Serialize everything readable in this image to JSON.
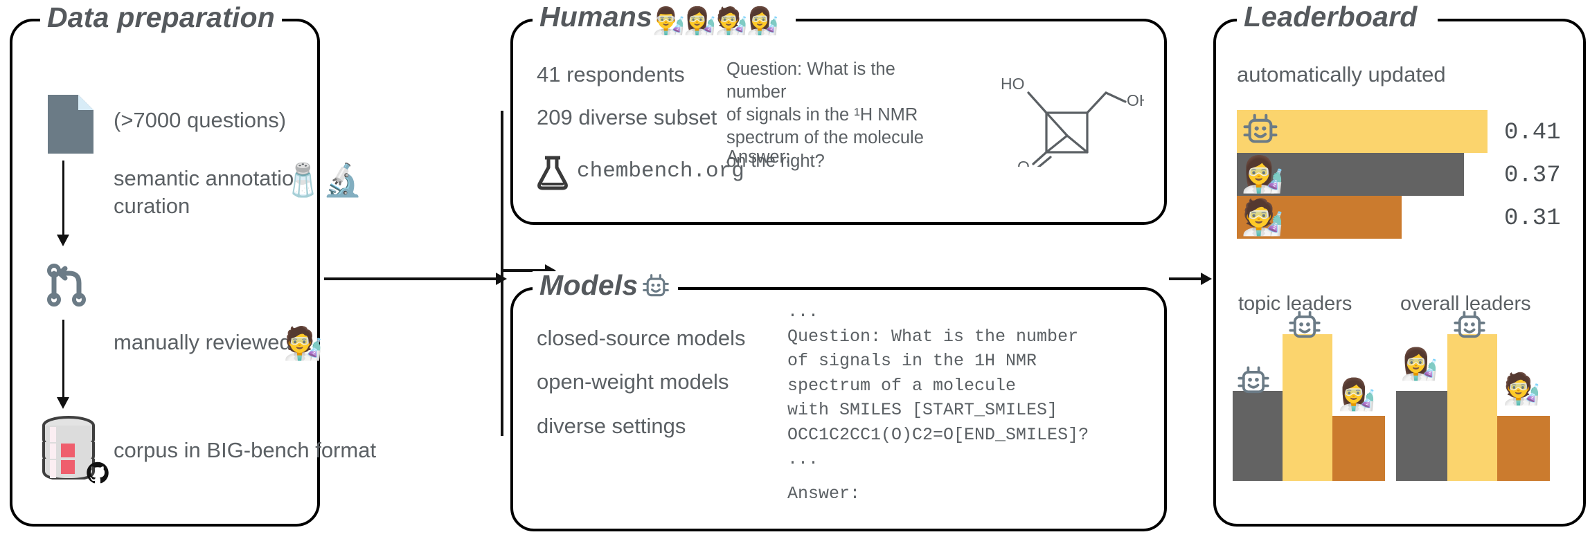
{
  "figure": {
    "panels": [
      "Data preparation",
      "Humans",
      "Models",
      "Leaderboard"
    ]
  },
  "data_preparation": {
    "title": "Data preparation",
    "steps": [
      {
        "icon": "document-icon",
        "label": "(>7000 questions)"
      },
      {
        "icon": "git-branch-icon",
        "label": "semantic annotation\ncuration",
        "line1": "semantic annotation",
        "line2": "curation"
      },
      {
        "icon": "git-branch-icon",
        "label": "manually reviewed"
      },
      {
        "icon": "database-icon",
        "label": "corpus in BIG-bench format"
      }
    ],
    "step1_label": "(>7000 questions)",
    "step2_line1": "semantic annotation",
    "step2_line2": "curation",
    "step3_label": "manually reviewed",
    "step4_label": "corpus in BIG-bench format",
    "badges": [
      "scientist-emoji",
      "scientist-emoji",
      "github-icon"
    ]
  },
  "humans": {
    "title": "Humans",
    "title_emojis": "👨‍🔬👩‍🔬🧑‍🔬👩‍🔬",
    "respondents": "41 respondents",
    "subset": "209 diverse subset",
    "site": "chembench.org",
    "site_icon": "flask-icon",
    "prompt_lines": [
      "Question: What is the number",
      "of signals in the ¹H NMR",
      "spectrum of the molecule",
      "on the right?"
    ],
    "answer_label": "Answer:",
    "molecule": {
      "name": "molecule-structure",
      "labels": [
        "HO",
        "OH",
        "O"
      ],
      "description": "2-hydroxy-3-(hydroxymethyl)bicyclo cyclobutanone"
    }
  },
  "models": {
    "title": "Models",
    "title_icon": "robot-icon",
    "items": [
      "closed-source models",
      "open-weight models",
      "diverse settings"
    ],
    "prompt_lines": [
      "...",
      "Question: What is the number",
      "of signals in the 1H NMR",
      "spectrum of a molecule",
      "with SMILES [START_SMILES]",
      "OCC1C2CC1(O)C2=O[END_SMILES]?",
      "..."
    ],
    "answer_label": "Answer:"
  },
  "leaderboard": {
    "title": "Leaderboard",
    "subtitle": "automatically updated",
    "topic_label": "topic leaders",
    "overall_label": "overall leaders",
    "colors": {
      "gold": "#FBD46D",
      "grey": "#636363",
      "orange": "#CB7B2E"
    },
    "chart_data": {
      "type": "bar",
      "orientation": "horizontal",
      "categories": [
        "robot-icon",
        "scientist-blonde-emoji",
        "scientist-brown-emoji"
      ],
      "values": [
        0.41,
        0.37,
        0.31
      ],
      "value_labels": [
        "0.41",
        "0.37",
        "0.31"
      ],
      "colors": [
        "#FBD46D",
        "#636363",
        "#CB7B2E"
      ],
      "title": "automatically updated",
      "xlabel": "",
      "ylabel": "",
      "xlim": [
        0,
        0.44
      ],
      "grid": false,
      "legend": false
    },
    "podiums": [
      {
        "label": "topic leaders",
        "places": [
          {
            "rank": 2,
            "height": 0.62,
            "color": "#636363",
            "icon": "robot-icon"
          },
          {
            "rank": 1,
            "height": 1.0,
            "color": "#FBD46D",
            "icon": "robot-icon"
          },
          {
            "rank": 3,
            "height": 0.44,
            "color": "#CB7B2E",
            "icon": "scientist-black-hair-emoji"
          }
        ]
      },
      {
        "label": "overall leaders",
        "places": [
          {
            "rank": 2,
            "height": 0.62,
            "color": "#636363",
            "icon": "scientist-blonde-emoji"
          },
          {
            "rank": 1,
            "height": 1.0,
            "color": "#FBD46D",
            "icon": "robot-icon"
          },
          {
            "rank": 3,
            "height": 0.44,
            "color": "#CB7B2E",
            "icon": "scientist-brown-emoji"
          }
        ]
      }
    ]
  }
}
